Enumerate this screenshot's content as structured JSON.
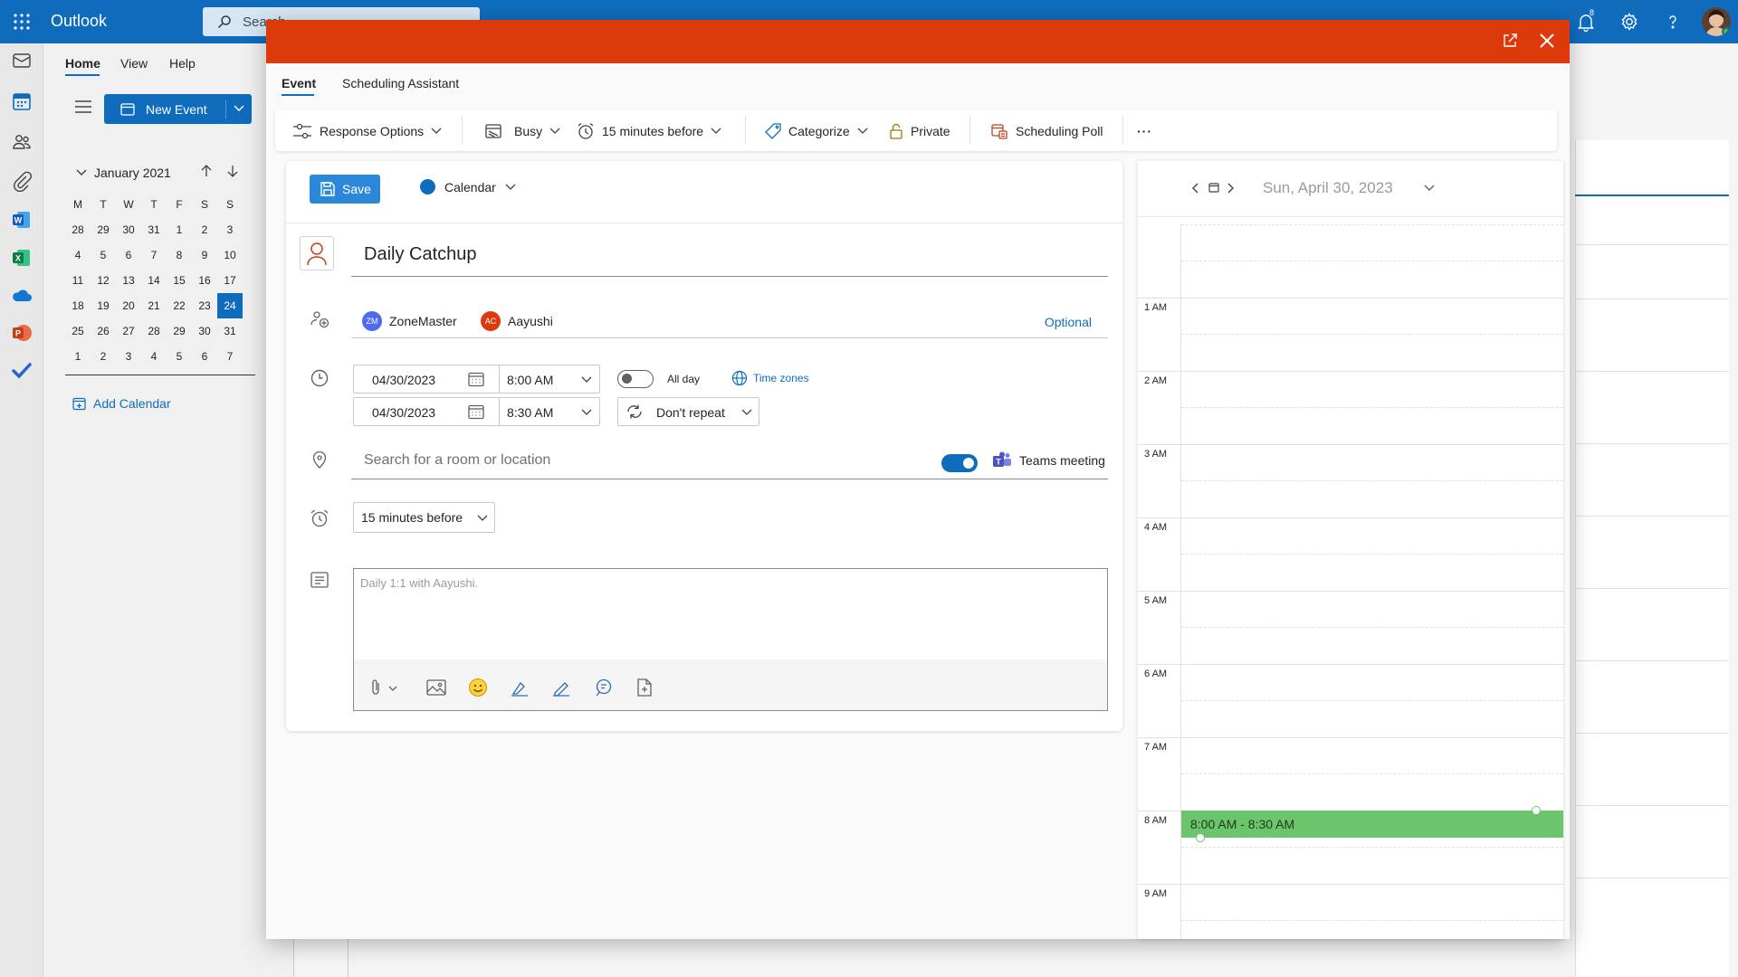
{
  "app": {
    "name": "Outlook",
    "search_placeholder": "Search",
    "notification_count": "8"
  },
  "ribbon_tabs": [
    "Home",
    "View",
    "Help"
  ],
  "left_nav": {
    "new_event_label": "New Event",
    "month_label": "January 2021",
    "weekday_headers": [
      "M",
      "T",
      "W",
      "T",
      "F",
      "S",
      "S"
    ],
    "weeks": [
      [
        "28",
        "29",
        "30",
        "31",
        "1",
        "2",
        "3"
      ],
      [
        "4",
        "5",
        "6",
        "7",
        "8",
        "9",
        "10"
      ],
      [
        "11",
        "12",
        "13",
        "14",
        "15",
        "16",
        "17"
      ],
      [
        "18",
        "19",
        "20",
        "21",
        "22",
        "23",
        "24"
      ],
      [
        "25",
        "26",
        "27",
        "28",
        "29",
        "30",
        "31"
      ],
      [
        "1",
        "2",
        "3",
        "4",
        "5",
        "6",
        "7"
      ]
    ],
    "selected_day": "24",
    "add_calendar_label": "Add Calendar"
  },
  "modal": {
    "tabs": {
      "event": "Event",
      "scheduling_assistant": "Scheduling Assistant"
    },
    "toolbar": {
      "response_options": "Response Options",
      "busy": "Busy",
      "reminder": "15 minutes before",
      "categorize": "Categorize",
      "private": "Private",
      "scheduling_poll": "Scheduling Poll",
      "more": "···"
    },
    "save_label": "Save",
    "calendar_label": "Calendar",
    "title": "Daily Catchup",
    "attendees": [
      {
        "initials": "ZM",
        "name": "ZoneMaster",
        "color": "#4f6bed"
      },
      {
        "initials": "AC",
        "name": "Aayushi",
        "color": "#dc3a0a"
      }
    ],
    "optional_label": "Optional",
    "start_date": "04/30/2023",
    "start_time": "8:00 AM",
    "end_date": "04/30/2023",
    "end_time": "8:30 AM",
    "all_day_label": "All day",
    "time_zones_label": "Time zones",
    "repeat_label": "Don't repeat",
    "location_placeholder": "Search for a room or location",
    "teams_label": "Teams meeting",
    "reminder_value": "15 minutes before",
    "body_placeholder": "Daily 1:1 with Aayushi."
  },
  "day_view": {
    "date_label": "Sun, April 30, 2023",
    "hours": [
      "1 AM",
      "2 AM",
      "3 AM",
      "4 AM",
      "5 AM",
      "6 AM",
      "7 AM",
      "8 AM",
      "9 AM"
    ],
    "event_label": "8:00 AM - 8:30 AM"
  },
  "colors": {
    "brand": "#0f6cbd",
    "header": "#dc3a0a",
    "event": "#6cc56c"
  }
}
